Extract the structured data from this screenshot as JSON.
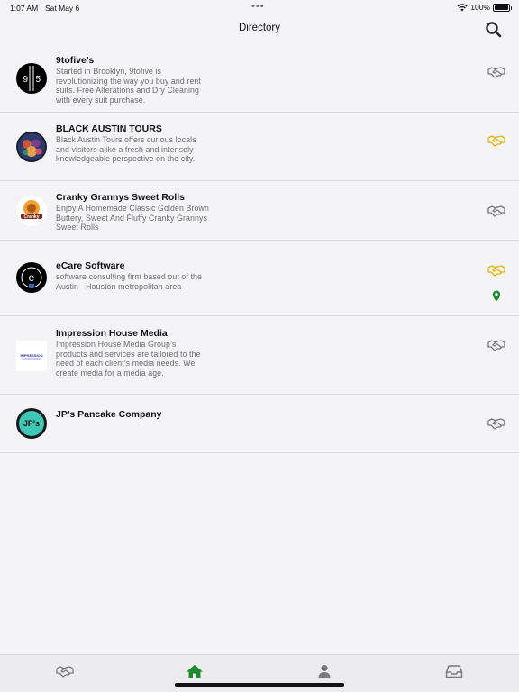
{
  "status_bar": {
    "time": "1:07 AM",
    "date": "Sat May 6",
    "dots": "•••",
    "battery_text": "100%"
  },
  "header": {
    "title": "Directory"
  },
  "icons": {
    "search": "search-icon",
    "handshake": "handshake-icon",
    "pin": "map-pin-icon",
    "home": "home-icon",
    "person": "person-icon",
    "inbox": "inbox-icon"
  },
  "colors": {
    "handshake_default": "#7a7a7e",
    "handshake_active": "#e5b400",
    "accent_green": "#1e8a2e",
    "text_secondary": "#6d6d72"
  },
  "listings": [
    {
      "name": "9tofive’s",
      "description": "Started in Brooklyn, 9tofive is revolutionizing the way you buy and rent suits. Free Alterations and Dry Cleaning with every suit purchase.",
      "logo_text_left": "9",
      "logo_text_right": "5",
      "handshake_state": "default"
    },
    {
      "name": "BLACK AUSTIN TOURS",
      "description": "Black Austin Tours offers curious locals and visitors alike a fresh and intensely knowledgeable perspective on the city.",
      "handshake_state": "active"
    },
    {
      "name": "Cranky Grannys Sweet Rolls",
      "description": "Enjoy A Homemade Classic Golden Brown Buttery, Sweet And Fluffy Cranky Grannys Sweet Rolls",
      "logo_text": "Cranky",
      "handshake_state": "default"
    },
    {
      "name": "eCare Software",
      "description": "software consulting firm based out of the Austin - Houston metropolitan area",
      "logo_text": "e",
      "handshake_state": "active",
      "has_location": true
    },
    {
      "name": "Impression House Media",
      "description": "Impression House Media Group’s products and services are tailored to the need of each client’s media needs. We create media for a media age.",
      "logo_text": "IMPRESSION",
      "handshake_state": "default"
    },
    {
      "name": "JP’s Pancake Company",
      "description": "",
      "logo_text": "JP's",
      "handshake_state": "default"
    }
  ],
  "tab_bar": {
    "tabs": [
      {
        "icon": "handshake-icon",
        "selected": false
      },
      {
        "icon": "home-icon",
        "selected": true
      },
      {
        "icon": "person-icon",
        "selected": false
      },
      {
        "icon": "inbox-icon",
        "selected": false
      }
    ]
  }
}
